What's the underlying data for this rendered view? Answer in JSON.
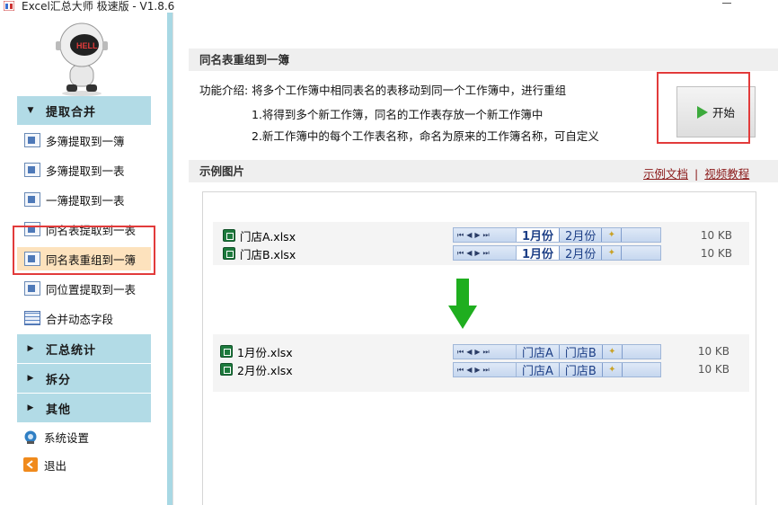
{
  "window": {
    "title": "Excel汇总大师 极速版 - V1.8.6"
  },
  "sidebar": {
    "sections": [
      {
        "label": "提取合并",
        "expanded": true
      },
      {
        "label": "汇总统计",
        "expanded": false
      },
      {
        "label": "拆分",
        "expanded": false
      },
      {
        "label": "其他",
        "expanded": false
      }
    ],
    "items": [
      {
        "label": "多簿提取到一簿"
      },
      {
        "label": "多簿提取到一表"
      },
      {
        "label": "一簿提取到一表"
      },
      {
        "label": "同名表提取到一表"
      },
      {
        "label": "同名表重组到一簿",
        "active": true
      },
      {
        "label": "同位置提取到一表"
      },
      {
        "label": "合并动态字段"
      }
    ],
    "other_items": [
      {
        "label": "系统设置"
      },
      {
        "label": "退出"
      }
    ]
  },
  "main": {
    "title": "同名表重组到一簿",
    "intro": "功能介绍: 将多个工作簿中相同表名的表移动到同一个工作簿中，进行重组",
    "step1": "1.将得到多个新工作簿，同名的工作表存放一个新工作簿中",
    "step2": "2.新工作簿中的每个工作表名称，命名为原来的工作簿名称，可自定义",
    "start_label": "开始",
    "example_title": "示例图片",
    "link_doc": "示例文档",
    "link_sep": "|",
    "link_video": "视频教程"
  },
  "example": {
    "before": [
      {
        "file": "门店A.xlsx",
        "tabs": [
          "1月份",
          "2月份"
        ],
        "size": "10 KB"
      },
      {
        "file": "门店B.xlsx",
        "tabs": [
          "1月份",
          "2月份"
        ],
        "size": "10 KB"
      }
    ],
    "after": [
      {
        "file": "1月份.xlsx",
        "tabs": [
          "门店A",
          "门店B"
        ],
        "size": "10 KB"
      },
      {
        "file": "2月份.xlsx",
        "tabs": [
          "门店A",
          "门店B"
        ],
        "size": "10 KB"
      }
    ],
    "nav_glyphs": "⏮◀▶⏭"
  },
  "colors": {
    "accent": "#b2dbe6",
    "active_item": "#fde2bd",
    "highlight": "#e23b3b",
    "arrow": "#22aa22"
  }
}
